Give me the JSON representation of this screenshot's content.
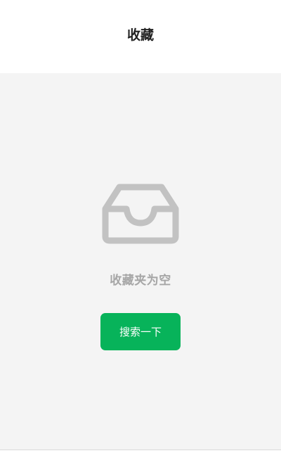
{
  "header": {
    "title": "收藏"
  },
  "empty_state": {
    "icon": "inbox-tray-icon",
    "message": "收藏夹为空",
    "button_label": "搜索一下"
  },
  "colors": {
    "accent": "#07b35a",
    "background": "#f4f4f4",
    "icon": "#c2c2c2",
    "muted_text": "#a6a6a6"
  }
}
